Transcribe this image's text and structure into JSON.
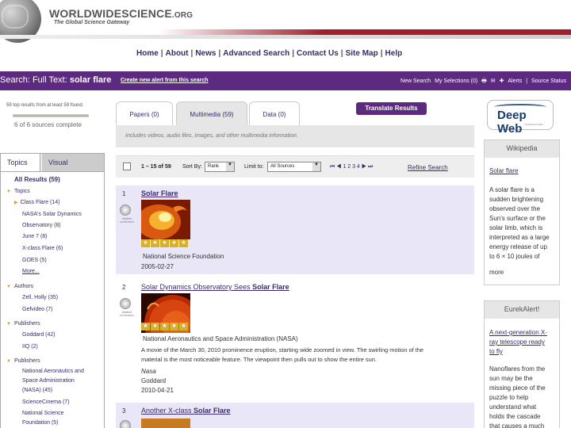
{
  "header": {
    "logo_main": "WORLDWIDESCIENCE",
    "logo_org": ".ORG",
    "tagline": "The Global Science Gateway"
  },
  "topnav": [
    "Home",
    "About",
    "News",
    "Advanced Search",
    "Contact Us",
    "Site Map",
    "Help"
  ],
  "searchbar": {
    "query_prefix": "Search: Full Text: ",
    "query_term": "solar flare",
    "alert_link": "Create new alert from this search",
    "right_links": [
      "New Search",
      "My Selections (0)",
      "🖶",
      "✉",
      "✚",
      "Alerts",
      "Source Status"
    ]
  },
  "status": {
    "results_found": "59 top results from at least 59 found.",
    "progress_fraction": 1.0,
    "sources": "6 of 6 sources complete"
  },
  "left_tabs": [
    "Topics",
    "Visual"
  ],
  "all_results": "All Results (59)",
  "facets": [
    {
      "label": "Topics",
      "level": 0
    },
    {
      "label": "Class Flare (14)",
      "level": 1
    },
    {
      "label": "NASA's Solar Dynamics",
      "level": 2
    },
    {
      "label": "Observatory (8)",
      "level": 2
    },
    {
      "label": "June 7 (8)",
      "level": 2
    },
    {
      "label": "X-class Flare (6)",
      "level": 2
    },
    {
      "label": "GOES (5)",
      "level": 2
    },
    {
      "label": "More...",
      "level": 2
    },
    {
      "label": "Authors",
      "level": 0
    },
    {
      "label": "Zell, Holly (35)",
      "level": 2
    },
    {
      "label": "Gefvideo (7)",
      "level": 2
    },
    {
      "label": "Publishers",
      "level": 0
    },
    {
      "label": "Goddard (42)",
      "level": 2
    },
    {
      "label": "IIQ (2)",
      "level": 2
    },
    {
      "label": "Publishers",
      "level": 0
    },
    {
      "label": "National Aeronautics and",
      "level": 2
    },
    {
      "label": "Space Administration",
      "level": 2
    },
    {
      "label": "(NASA) (45)",
      "level": 2
    },
    {
      "label": "ScienceCinema (7)",
      "level": 2
    },
    {
      "label": "National Science",
      "level": 2
    },
    {
      "label": "Foundation (5)",
      "level": 2
    }
  ],
  "main_tabs": [
    "Papers (0)",
    "Multimedia (59)",
    "Data (0)"
  ],
  "translate_button": "Translate Results",
  "info_text": "Includes videos, audio files, images, and other multimedia information.",
  "toolbar": {
    "range": "1 – 15 of 59",
    "sort_label": "Sort By:",
    "sort_value": "Rank",
    "limit_label": "Limit to:",
    "limit_value": "All Sources",
    "pages": "1 2 3 4",
    "refine": "Refine Search"
  },
  "results": [
    {
      "num": "1",
      "title_plain": "",
      "title_bold": "Solar Flare",
      "cite_label": "citation\ncorrection",
      "publisher": "National Science Foundation",
      "date": "2005-02-27",
      "stars": 5
    },
    {
      "num": "2",
      "title_plain": "Solar Dynamics Observatory Sees ",
      "title_bold": "Solar Flare",
      "cite_label": "citation\ncorrection",
      "publisher": "National Aeronautics and Space Administration (NASA)",
      "desc1": "A movie of the March 30, 2010 prominence eruption, starting wide zoomed in view. The swirling motion of the",
      "desc2": "material is the most noticeable feature. The viewpoint then pulls out to show the entire sun.",
      "author": "Nasa",
      "source": "Goddard",
      "date": "2010-04-21",
      "stars": 5
    },
    {
      "num": "3",
      "title_plain": "Another X-class ",
      "title_bold": "Solar Flare"
    }
  ],
  "deepweb": {
    "logo": "Deep Web",
    "sub": "TECHNOLOGIES"
  },
  "wikipedia": {
    "heading": "Wikipedia",
    "link": "Solar flare",
    "text_lines": [
      "A solar flare is a",
      "sudden brightening",
      "observed over the",
      "Sun's surface or the",
      "solar limb, which is",
      "interpreted as a large",
      "energy release of up",
      "to 6 × 10 joules of"
    ],
    "more": "more"
  },
  "eurekalert": {
    "heading": "EurekAlert!",
    "link_lines": [
      "A next-generation X-",
      "ray telescope ready",
      "to fly"
    ],
    "text_lines": [
      "Nanoflares from the",
      "sun may be the",
      "missing piece of the",
      "puzzle to help",
      "understand what",
      "holds the cascade",
      "that causes a much"
    ]
  },
  "colors": {
    "brand_purple": "#5c2a7e",
    "link": "#3a2a6a",
    "star_gold": "#d8b030",
    "row_shade": "#e8e6f7"
  }
}
